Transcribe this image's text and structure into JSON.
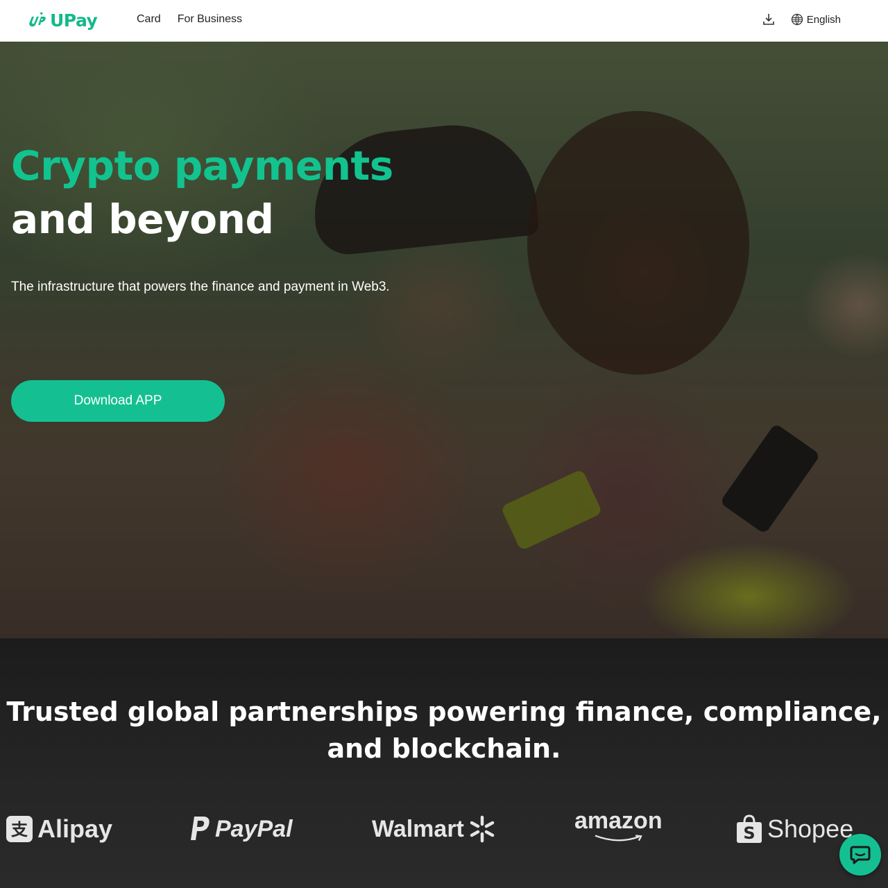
{
  "header": {
    "brand": "UPay",
    "nav": [
      {
        "label": "Card"
      },
      {
        "label": "For Business"
      }
    ],
    "language_label": "English"
  },
  "hero": {
    "title_line1": "Crypto payments",
    "title_line2": "and beyond",
    "subtitle": "The infrastructure that powers the finance and payment in Web3.",
    "cta_label": "Download APP"
  },
  "partners": {
    "title": "Trusted global partnerships powering finance, compliance, and blockchain.",
    "logos": [
      {
        "name": "Alipay"
      },
      {
        "name": "PayPal"
      },
      {
        "name": "Walmart"
      },
      {
        "name": "amazon"
      },
      {
        "name": "Shopee"
      }
    ]
  },
  "colors": {
    "accent": "#14c092",
    "header_bg": "#ffffff",
    "dark_bg": "#1f1f1f"
  },
  "icons": [
    "upay-logo-icon",
    "download-icon",
    "globe-icon",
    "chat-icon"
  ]
}
